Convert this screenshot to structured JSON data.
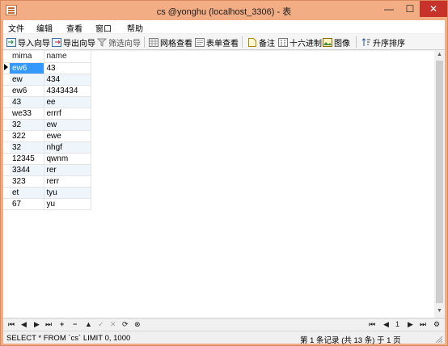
{
  "window": {
    "title": "cs @yonghu (localhost_3306) - 表",
    "minimize": "—",
    "maximize": "☐",
    "close": "✕"
  },
  "menu": [
    "文件",
    "编辑",
    "查看",
    "窗口",
    "帮助"
  ],
  "toolbar": {
    "import": "导入向导",
    "export": "导出向导",
    "filter": "筛选向导",
    "grid_view": "网格查看",
    "form_view": "表单查看",
    "memo": "备注",
    "hex": "十六进制",
    "image": "图像",
    "sort_asc": "升序排序"
  },
  "table": {
    "columns": [
      "mima",
      "name"
    ],
    "rows": [
      [
        "ew6",
        "43"
      ],
      [
        "ew",
        "434"
      ],
      [
        "ew6",
        "4343434"
      ],
      [
        "43",
        "ee"
      ],
      [
        "we33",
        "errrf"
      ],
      [
        "32",
        "ew"
      ],
      [
        "322",
        "ewe"
      ],
      [
        "32",
        "nhgf"
      ],
      [
        "12345",
        "qwnm"
      ],
      [
        "3344",
        "rer"
      ],
      [
        "323",
        "rerr"
      ],
      [
        "et",
        "tyu"
      ],
      [
        "67",
        "yu"
      ]
    ]
  },
  "navbar": {
    "first": "⏮",
    "prev": "◀",
    "next": "▶",
    "last": "⏭",
    "add": "+",
    "delete": "−",
    "up": "▲",
    "apply": "✓",
    "cancel": "✕",
    "refresh": "⟳",
    "stop": "⊗",
    "page": "1",
    "page_first": "⏮",
    "page_prev": "◀",
    "page_next": "▶",
    "page_last": "⏭",
    "settings": "⚙"
  },
  "status": {
    "sql": "SELECT * FROM `cs` LIMIT 0, 1000",
    "records": "第 1 条记录 (共 13 条) 于 1 页"
  },
  "colors": {
    "titlebar": "#f3ad84",
    "close": "#c7332b",
    "selection": "#3399ff",
    "alt_row": "#eef5fb"
  }
}
